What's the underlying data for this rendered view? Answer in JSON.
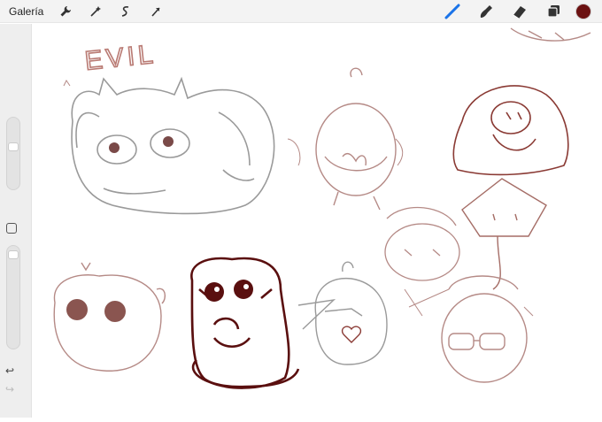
{
  "toolbar": {
    "gallery_label": "Galería",
    "left_tools": [
      "wrench-icon",
      "magic-wand-icon",
      "selection-icon",
      "transform-icon"
    ],
    "right_tools": [
      "brush-icon",
      "smudge-icon",
      "eraser-icon",
      "layers-icon"
    ],
    "active_tool": "brush-icon",
    "active_color": "#6b1111"
  },
  "sidebar": {
    "size_level": 0.6,
    "opacity_level": 0.95,
    "undo_icon": "undo-icon",
    "redo_icon": "redo-icon"
  },
  "canvas": {
    "sketch_text": "EVIL",
    "ink_colors": [
      "#b97a73",
      "#9a9a9a",
      "#5a0f0f"
    ]
  }
}
